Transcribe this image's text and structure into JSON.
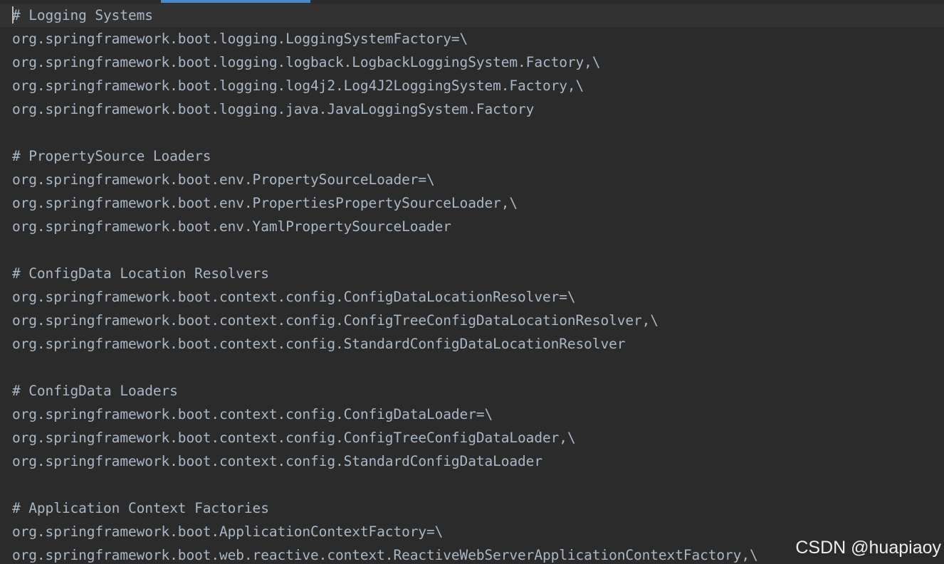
{
  "editor": {
    "lines": [
      "# Logging Systems",
      "org.springframework.boot.logging.LoggingSystemFactory=\\",
      "org.springframework.boot.logging.logback.LogbackLoggingSystem.Factory,\\",
      "org.springframework.boot.logging.log4j2.Log4J2LoggingSystem.Factory,\\",
      "org.springframework.boot.logging.java.JavaLoggingSystem.Factory",
      "",
      "# PropertySource Loaders",
      "org.springframework.boot.env.PropertySourceLoader=\\",
      "org.springframework.boot.env.PropertiesPropertySourceLoader,\\",
      "org.springframework.boot.env.YamlPropertySourceLoader",
      "",
      "# ConfigData Location Resolvers",
      "org.springframework.boot.context.config.ConfigDataLocationResolver=\\",
      "org.springframework.boot.context.config.ConfigTreeConfigDataLocationResolver,\\",
      "org.springframework.boot.context.config.StandardConfigDataLocationResolver",
      "",
      "# ConfigData Loaders",
      "org.springframework.boot.context.config.ConfigDataLoader=\\",
      "org.springframework.boot.context.config.ConfigTreeConfigDataLoader,\\",
      "org.springframework.boot.context.config.StandardConfigDataLoader",
      "",
      "# Application Context Factories",
      "org.springframework.boot.ApplicationContextFactory=\\",
      "org.springframework.boot.web.reactive.context.ReactiveWebServerApplicationContextFactory,\\"
    ]
  },
  "watermark": "CSDN @huapiaoy",
  "colors": {
    "background": "#2b2b2b",
    "text": "#a9b7c6",
    "tab_indicator": "#4a88c7",
    "current_line": "#323232"
  }
}
